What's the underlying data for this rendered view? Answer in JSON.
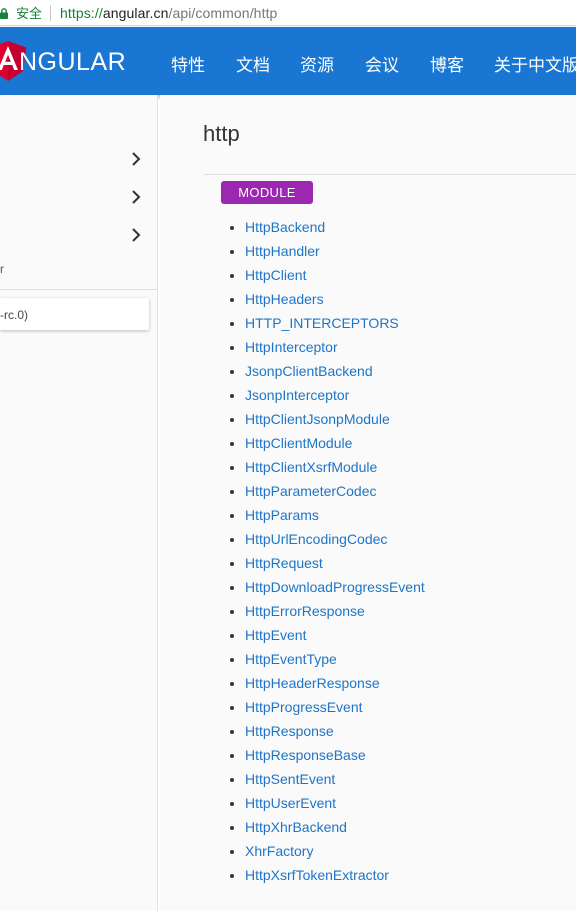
{
  "address_bar": {
    "secure_label": "安全",
    "url_scheme": "https://",
    "url_host": "angular.cn",
    "url_path": "/api/common/http"
  },
  "nav": {
    "brand": "NGULAR",
    "items": [
      "特性",
      "文档",
      "资源",
      "会议",
      "博客",
      "关于中文版"
    ]
  },
  "sidebar": {
    "fragment_text": "r",
    "version_text": "-rc.0)"
  },
  "main": {
    "title": "http",
    "badge": "MODULE",
    "entries": [
      "HttpBackend",
      "HttpHandler",
      "HttpClient",
      "HttpHeaders",
      "HTTP_INTERCEPTORS",
      "HttpInterceptor",
      "JsonpClientBackend",
      "JsonpInterceptor",
      "HttpClientJsonpModule",
      "HttpClientModule",
      "HttpClientXsrfModule",
      "HttpParameterCodec",
      "HttpParams",
      "HttpUrlEncodingCodec",
      "HttpRequest",
      "HttpDownloadProgressEvent",
      "HttpErrorResponse",
      "HttpEvent",
      "HttpEventType",
      "HttpHeaderResponse",
      "HttpProgressEvent",
      "HttpResponse",
      "HttpResponseBase",
      "HttpSentEvent",
      "HttpUserEvent",
      "HttpXhrBackend",
      "XhrFactory",
      "HttpXsrfTokenExtractor"
    ]
  },
  "colors": {
    "nav_bg": "#1976d2",
    "badge_bg": "#9c27b0",
    "link": "#1e75c7",
    "secure": "#188038"
  }
}
